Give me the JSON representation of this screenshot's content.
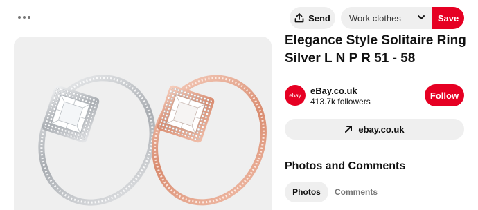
{
  "pin": {
    "title": "Elegance Style Solitaire Ring Silver L N P R 51 - 58",
    "image_alt": "Two square halo solitaire rings, one silver and one rose gold"
  },
  "actions": {
    "send_label": "Send",
    "board_value": "Work clothes",
    "save_label": "Save"
  },
  "source": {
    "logo_text": "ebay",
    "name": "eBay.co.uk",
    "followers": "413.7k followers",
    "follow_label": "Follow",
    "link_label": "ebay.co.uk"
  },
  "comments": {
    "section_title": "Photos and Comments",
    "tabs": [
      {
        "label": "Photos",
        "active": true
      },
      {
        "label": "Comments",
        "active": false
      }
    ]
  },
  "colors": {
    "brand_red": "#e60023",
    "pill_gray": "#efefef",
    "silver": "#c9ccd0",
    "rose_gold": "#e5a58c"
  }
}
